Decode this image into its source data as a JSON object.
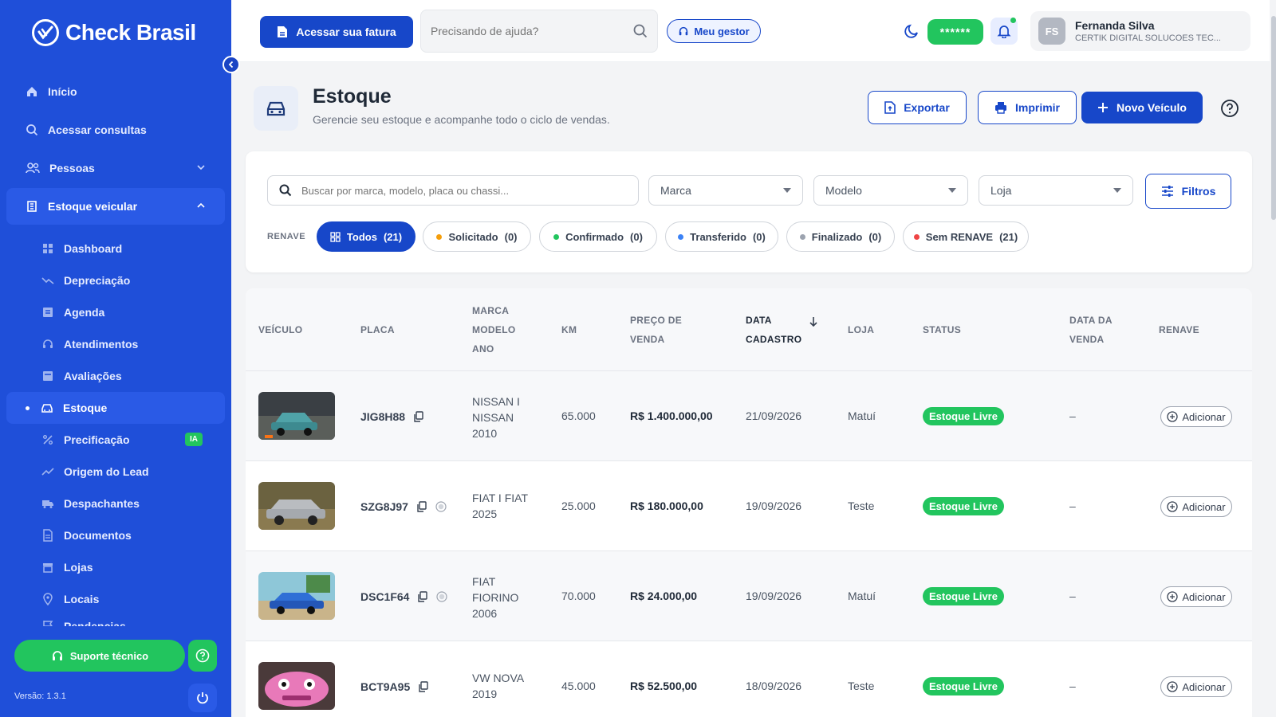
{
  "app": {
    "brand": "Check Brasil",
    "version": "Versão: 1.3.1"
  },
  "colors": {
    "primary": "#1747c9",
    "sidebar": "#1f4fd9",
    "success": "#22c55e"
  },
  "sidebar": {
    "nav": [
      {
        "label": "Início",
        "icon": "home-icon"
      },
      {
        "label": "Acessar consultas",
        "icon": "search-icon"
      },
      {
        "label": "Pessoas",
        "icon": "people-icon"
      },
      {
        "label": "Estoque veicular",
        "icon": "building-icon"
      }
    ],
    "sub": [
      {
        "label": "Dashboard"
      },
      {
        "label": "Depreciação"
      },
      {
        "label": "Agenda"
      },
      {
        "label": "Atendimentos"
      },
      {
        "label": "Avaliações"
      },
      {
        "label": "Estoque"
      },
      {
        "label": "Precificação",
        "badge": "IA"
      },
      {
        "label": "Origem do Lead"
      },
      {
        "label": "Despachantes"
      },
      {
        "label": "Documentos"
      },
      {
        "label": "Lojas"
      },
      {
        "label": "Locais"
      },
      {
        "label": "Pendencias"
      }
    ],
    "support_label": "Suporte técnico"
  },
  "header": {
    "fatura_label": "Acessar sua fatura",
    "help_placeholder": "Precisando de ajuda?",
    "gestor_label": "Meu gestor",
    "masked": "******",
    "user": {
      "initials": "FS",
      "name": "Fernanda Silva",
      "company": "CERTIK DIGITAL SOLUCOES TEC..."
    }
  },
  "page": {
    "title": "Estoque",
    "subtitle": "Gerencie seu estoque e acompanhe todo o ciclo de vendas.",
    "export_label": "Exportar",
    "print_label": "Imprimir",
    "new_label": "Novo Veículo"
  },
  "filters": {
    "search_placeholder": "Buscar por marca, modelo, placa ou chassi...",
    "marca": "Marca",
    "modelo": "Modelo",
    "loja": "Loja",
    "filtros_label": "Filtros",
    "renave_label": "RENAVE",
    "chips": [
      {
        "label": "Todos",
        "count": "(21)",
        "color": ""
      },
      {
        "label": "Solicitado",
        "count": "(0)",
        "color": "#f59e0b"
      },
      {
        "label": "Confirmado",
        "count": "(0)",
        "color": "#22c55e"
      },
      {
        "label": "Transferido",
        "count": "(0)",
        "color": "#3b82f6"
      },
      {
        "label": "Finalizado",
        "count": "(0)",
        "color": "#9ca3af"
      },
      {
        "label": "Sem RENAVE",
        "count": "(21)",
        "color": "#ef4444"
      }
    ]
  },
  "table": {
    "headers": {
      "veiculo": "VEÍCULO",
      "placa": "PLACA",
      "marca": [
        "MARCA",
        "MODELO",
        "ANO"
      ],
      "km": "KM",
      "preco": [
        "PREÇO DE",
        "VENDA"
      ],
      "data_cadastro": [
        "DATA",
        "CADASTRO"
      ],
      "loja": "LOJA",
      "status": "STATUS",
      "data_venda": [
        "DATA DA",
        "VENDA"
      ],
      "renave": "RENAVE"
    },
    "rows": [
      {
        "plate": "JIG8H88",
        "model": [
          "NISSAN I",
          "NISSAN",
          "2010"
        ],
        "km": "65.000",
        "price": "R$ 1.400.000,00",
        "date": "21/09/2026",
        "store": "Matuí",
        "status": "Estoque Livre",
        "sale_date": "–",
        "renave": "Adicionar"
      },
      {
        "plate": "SZG8J97",
        "model": [
          "FIAT I FIAT",
          "2025"
        ],
        "km": "25.000",
        "price": "R$ 180.000,00",
        "date": "19/09/2026",
        "store": "Teste",
        "status": "Estoque Livre",
        "sale_date": "–",
        "renave": "Adicionar"
      },
      {
        "plate": "DSC1F64",
        "model": [
          "FIAT",
          "FIORINO",
          "2006"
        ],
        "km": "70.000",
        "price": "R$ 24.000,00",
        "date": "19/09/2026",
        "store": "Matuí",
        "status": "Estoque Livre",
        "sale_date": "–",
        "renave": "Adicionar"
      },
      {
        "plate": "BCT9A95",
        "model": [
          "VW NOVA",
          "2019"
        ],
        "km": "45.000",
        "price": "R$ 52.500,00",
        "date": "18/09/2026",
        "store": "Teste",
        "status": "Estoque Livre",
        "sale_date": "–",
        "renave": "Adicionar"
      }
    ]
  }
}
